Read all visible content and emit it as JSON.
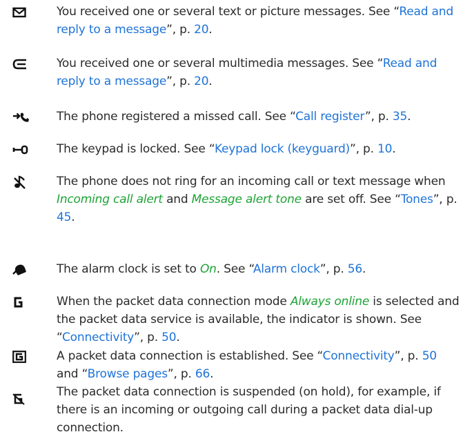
{
  "colors": {
    "link": "#1e73d8",
    "term": "#1ea336",
    "text": "#2b2b2b",
    "icon": "#111111"
  },
  "items": [
    {
      "icon": "envelope-icon",
      "t1": "You received one or several text or picture messages. See “",
      "link1": "Read and reply to a message",
      "t2": "”, p. ",
      "page1": "20",
      "t3": "."
    },
    {
      "icon": "multimedia-message-icon",
      "t1": "You received one or several multimedia messages. See “",
      "link1": "Read and reply to a message",
      "t2": "”, p. ",
      "page1": "20",
      "t3": "."
    },
    {
      "icon": "missed-call-icon",
      "t1": "The phone registered a missed call. See “",
      "link1": "Call register",
      "t2": "”, p. ",
      "page1": "35",
      "t3": "."
    },
    {
      "icon": "keypad-lock-icon",
      "t1": "The keypad is locked. See “",
      "link1": "Keypad lock (keyguard)",
      "t2": "”, p. ",
      "page1": "10",
      "t3": "."
    },
    {
      "icon": "silent-ringing-icon",
      "t1": "The phone does not ring for an incoming call or text message when ",
      "em1": "Incoming call alert",
      "t2": " and ",
      "em2": "Message alert tone",
      "t3": " are set off. See “",
      "link1": "Tones",
      "t4": "”, p. ",
      "page1": "45",
      "t5": "."
    },
    {
      "icon": "alarm-clock-icon",
      "t1": "The alarm clock is set to ",
      "em1": "On",
      "t2": ". See “",
      "link1": "Alarm clock",
      "t3": "”, p. ",
      "page1": "56",
      "t4": "."
    },
    {
      "icon": "packet-data-available-icon",
      "t1": "When the packet data connection mode ",
      "em1": "Always online",
      "t2": " is selected and the packet data service is available, the indicator is shown. See “",
      "link1": "Connectivity",
      "t3": "”, p. ",
      "page1": "50",
      "t4": "."
    },
    {
      "icon": "packet-data-connected-icon",
      "t1": "A packet data connection is established. See “",
      "link1": "Connectivity",
      "t2": "”, p. ",
      "page1": "50",
      "t3": " and “",
      "link2": "Browse pages",
      "t4": "”, p. ",
      "page2": "66",
      "t5": "."
    },
    {
      "icon": "packet-data-suspended-icon",
      "t1": "The packet data connection is suspended (on hold), for example, if there is an incoming or outgoing call during a packet data dial-up connection."
    }
  ]
}
